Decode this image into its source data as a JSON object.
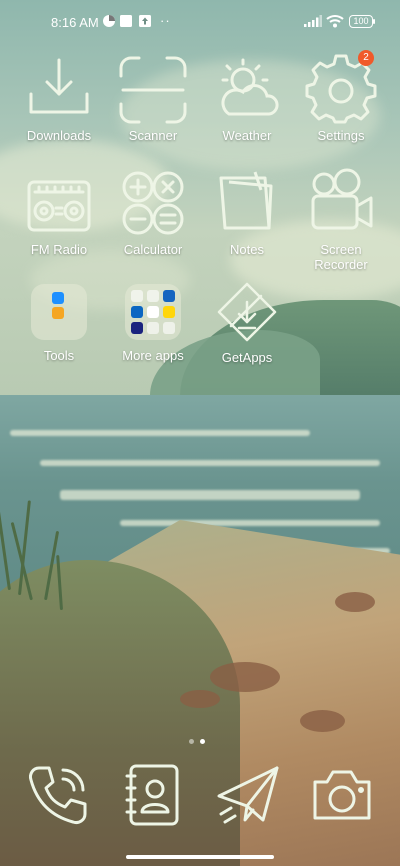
{
  "status_bar": {
    "time": "8:16 AM",
    "icons": [
      "theme-app-icon",
      "gallery-icon",
      "upload-icon"
    ],
    "more": "··",
    "battery": "100",
    "signal_icon": "signal-icon",
    "wifi_icon": "wifi-icon"
  },
  "apps": {
    "downloads": "Downloads",
    "scanner": "Scanner",
    "weather": "Weather",
    "settings": "Settings",
    "settings_badge": "2",
    "fm_radio": "FM Radio",
    "calculator": "Calculator",
    "notes": "Notes",
    "screen_recorder_line1": "Screen",
    "screen_recorder_line2": "Recorder",
    "tools": "Tools",
    "more_apps": "More apps",
    "getapps": "GetApps"
  },
  "dock": [
    "phone-icon",
    "contacts-icon",
    "messages-icon",
    "camera-icon"
  ],
  "pager": {
    "pages": 2,
    "active": 2
  },
  "colors": {
    "icon_stroke": "#eef5e6",
    "badge": "#f05a2a",
    "text": "#ffffff"
  }
}
